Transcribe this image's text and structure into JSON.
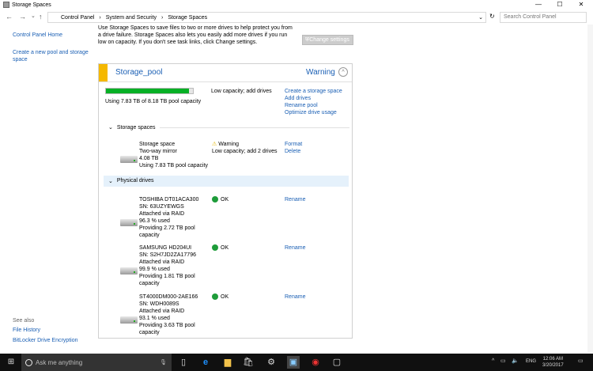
{
  "window": {
    "title": "Storage Spaces",
    "minimize": "—",
    "maximize": "☐",
    "close": "✕"
  },
  "nav": {
    "back": "←",
    "forward": "→",
    "recent": "⌄",
    "up": "↑",
    "breadcrumb": [
      "Control Panel",
      "System and Security",
      "Storage Spaces"
    ],
    "refresh": "↻",
    "search_placeholder": "Search Control Panel"
  },
  "sidebar": {
    "items": [
      {
        "label": "Control Panel Home"
      },
      {
        "label": "Create a new pool and storage space"
      }
    ],
    "see_also": "See also",
    "see_also_items": [
      {
        "label": "File History"
      },
      {
        "label": "BitLocker Drive Encryption"
      }
    ]
  },
  "intro": "Use Storage Spaces to save files to two or more drives to help protect you from a drive failure. Storage Spaces also lets you easily add more drives if you run low on capacity. If you don't see task links, click Change settings.",
  "change_settings": "Change settings",
  "pool": {
    "name": "Storage_pool",
    "status": "Warning",
    "usage_percent": 95.7,
    "usage_text": "Using 7.83 TB of 8.18 TB pool capacity",
    "message": "Low capacity; add drives",
    "links": [
      "Create a storage space",
      "Add drives",
      "Rename pool",
      "Optimize drive usage"
    ],
    "colors": {
      "warning": "#f5b800",
      "bar": "#06b025",
      "accent": "#1a5fb4"
    }
  },
  "storage_spaces": {
    "header": "Storage spaces",
    "items": [
      {
        "lines": [
          "Storage space",
          "Two-way mirror",
          "4.08 TB",
          "Using 7.83 TB pool capacity"
        ],
        "status": "Warning",
        "status_detail": "Low capacity; add 2 drives",
        "links": [
          "Format",
          "Delete"
        ]
      }
    ]
  },
  "physical_drives": {
    "header": "Physical drives",
    "items": [
      {
        "lines": [
          "TOSHIBA DT01ACA300",
          "SN: 63UZYEWGS",
          "Attached via RAID",
          "96.3 % used",
          "Providing 2.72 TB pool",
          "capacity"
        ],
        "status": "OK",
        "link": "Rename"
      },
      {
        "lines": [
          "SAMSUNG HD204UI",
          "SN: S2H7JD2ZA17796",
          "Attached via RAID",
          "99.9 % used",
          "Providing 1.81 TB pool",
          "capacity"
        ],
        "status": "OK",
        "link": "Rename"
      },
      {
        "lines": [
          "ST4000DM000-2AE166",
          "SN: WDH0089S",
          "Attached via RAID",
          "93.1 % used",
          "Providing 3.63 TB pool",
          "capacity"
        ],
        "status": "OK",
        "link": "Rename"
      }
    ]
  },
  "taskbar": {
    "search_placeholder": "Ask me anything",
    "lang": "ENG",
    "time": "12:06 AM",
    "date": "3/20/2017"
  }
}
